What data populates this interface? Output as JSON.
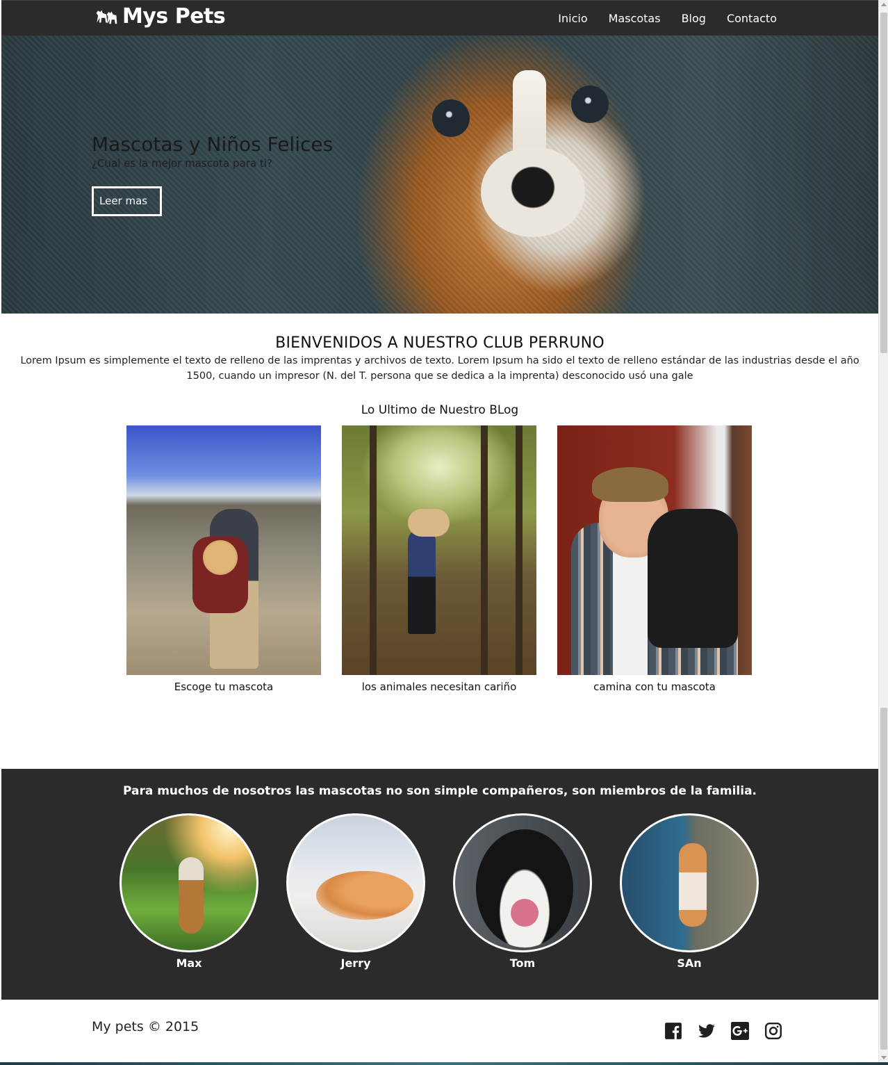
{
  "navbar": {
    "brand": "Mys Pets",
    "brand_icon": "dogs-icon",
    "links": [
      "Inicio",
      "Mascotas",
      "Blog",
      "Contacto"
    ]
  },
  "hero": {
    "title": "Mascotas y Niños Felices",
    "subtitle": "¿Cual es la mejor mascota para ti?",
    "button": "Leer mas"
  },
  "welcome": {
    "heading": "BIENVENIDOS A NUESTRO CLUB PERRUNO",
    "text": "Lorem Ipsum es simplemente el texto de relleno de las imprentas y archivos de texto. Lorem Ipsum ha sido el texto de relleno estándar de las industrias desde el año 1500, cuando un impresor (N. del T. persona que se dedica a la imprenta) desconocido usó una gale"
  },
  "blog": {
    "title": "Lo Ultimo de Nuestro BLog",
    "cards": [
      {
        "caption": "Escoge tu mascota"
      },
      {
        "caption": "los animales necesitan cariño"
      },
      {
        "caption": "camina con tu mascota"
      }
    ]
  },
  "pets_section": {
    "title": "Para muchos de nosotros las mascotas no son simple compañeros, son miembros de la familia.",
    "pets": [
      {
        "name": "Max"
      },
      {
        "name": "Jerry"
      },
      {
        "name": "Tom"
      },
      {
        "name": "SAn"
      }
    ]
  },
  "footer": {
    "copyright": "My pets © 2015",
    "social": [
      "facebook-icon",
      "twitter-icon",
      "google-plus-icon",
      "instagram-icon"
    ]
  },
  "colors": {
    "navbar_bg": "#2b2b2b",
    "dark_section_bg": "#2b2b2b",
    "text": "#222222",
    "white": "#ffffff"
  }
}
